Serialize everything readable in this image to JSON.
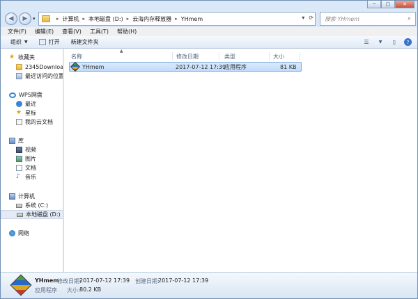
{
  "window_controls": {
    "minimize": "─",
    "maximize": "□",
    "close": "✕"
  },
  "address": {
    "crumbs": [
      "计算机",
      "本地磁盘 (D:)",
      "云海内存释放器",
      "YHmem"
    ],
    "search_placeholder": "搜索 YHmem"
  },
  "menu": [
    "文件(F)",
    "编辑(E)",
    "查看(V)",
    "工具(T)",
    "帮助(H)"
  ],
  "toolbar": {
    "organize": "组织",
    "open": "打开",
    "new_folder": "新建文件夹"
  },
  "nav": {
    "favorites": {
      "label": "收藏夹",
      "items": [
        "2345Downloads",
        "最近访问的位置"
      ]
    },
    "wps": {
      "label": "WPS网盘",
      "items": [
        "最近",
        "星标",
        "我的云文档"
      ]
    },
    "library": {
      "label": "库",
      "items": [
        "视频",
        "图片",
        "文档",
        "音乐"
      ]
    },
    "computer": {
      "label": "计算机",
      "items": [
        "系统 (C:)",
        "本地磁盘 (D:)"
      ]
    },
    "network": {
      "label": "网络"
    }
  },
  "columns": {
    "name": "名称",
    "date": "修改日期",
    "type": "类型",
    "size": "大小"
  },
  "files": [
    {
      "name": "YHmem",
      "date": "2017-07-12 17:39",
      "type": "应用程序",
      "size": "81 KB"
    }
  ],
  "details": {
    "name": "YHmem",
    "type": "应用程序",
    "modified_label": "修改日期:",
    "modified": "2017-07-12 17:39",
    "created_label": "创建日期:",
    "created": "2017-07-12 17:39",
    "size_label": "大小:",
    "size": "80.2 KB"
  }
}
